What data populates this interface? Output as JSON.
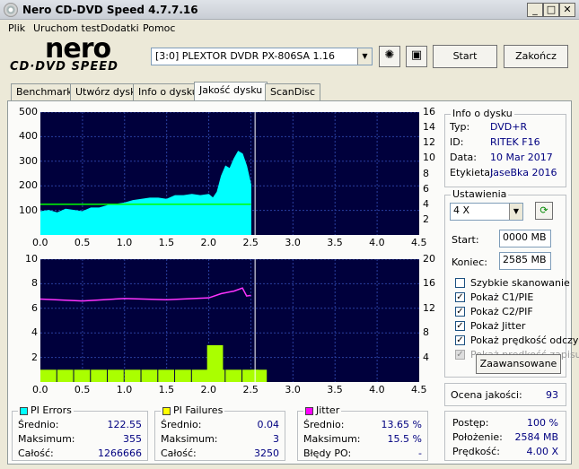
{
  "window": {
    "title": "Nero CD-DVD Speed 4.7.7.16"
  },
  "menu": [
    "Plik",
    "Uruchom test",
    "Dodatki",
    "Pomoc"
  ],
  "logo": {
    "top": "nero",
    "bottom": "CD·DVD SPEED"
  },
  "drive": {
    "selected": "[3:0]  PLEXTOR DVDR   PX-806SA  1.16"
  },
  "buttons": {
    "start": "Start",
    "end": "Zakończ",
    "advanced": "Zaawansowane"
  },
  "tabs": [
    "Benchmark",
    "Utwórz dysk",
    "Info o dysku",
    "Jakość dysku",
    "ScanDisc"
  ],
  "active_tab": 3,
  "disc_info": {
    "title": "Info o dysku",
    "rows": [
      {
        "label": "Typ:",
        "value": "DVD+R"
      },
      {
        "label": "ID:",
        "value": "RITEK F16"
      },
      {
        "label": "Data:",
        "value": "10 Mar 2017"
      },
      {
        "label": "Etykieta:",
        "value": "JaseBka 2016"
      }
    ]
  },
  "settings": {
    "title": "Ustawienia",
    "speed": "4 X",
    "start_label": "Start:",
    "start_value": "0000 MB",
    "end_label": "Koniec:",
    "end_value": "2585 MB",
    "checks": [
      {
        "label": "Szybkie skanowanie",
        "checked": false,
        "disabled": false
      },
      {
        "label": "Pokaż C1/PIE",
        "checked": true,
        "disabled": false
      },
      {
        "label": "Pokaż C2/PIF",
        "checked": true,
        "disabled": false
      },
      {
        "label": "Pokaż Jitter",
        "checked": true,
        "disabled": false
      },
      {
        "label": "Pokaż prędkość odczy",
        "checked": true,
        "disabled": false
      },
      {
        "label": "Pokaż prędkość zapisu",
        "checked": true,
        "disabled": true
      }
    ]
  },
  "quality": {
    "label": "Ocena jakości:",
    "value": "93"
  },
  "progress": {
    "rows": [
      {
        "label": "Postęp:",
        "value": "100 %"
      },
      {
        "label": "Położenie:",
        "value": "2584 MB"
      },
      {
        "label": "Prędkość:",
        "value": "4.00 X"
      }
    ]
  },
  "stats": {
    "pi_errors": {
      "title": "PI Errors",
      "color": "#00ffff",
      "rows": [
        {
          "label": "Średnio:",
          "value": "122.55"
        },
        {
          "label": "Maksimum:",
          "value": "355"
        },
        {
          "label": "Całość:",
          "value": "1266666"
        }
      ]
    },
    "pi_failures": {
      "title": "PI Failures",
      "color": "#ffff00",
      "rows": [
        {
          "label": "Średnio:",
          "value": "0.04"
        },
        {
          "label": "Maksimum:",
          "value": "3"
        },
        {
          "label": "Całość:",
          "value": "3250"
        }
      ]
    },
    "jitter": {
      "title": "Jitter",
      "color": "#ff00ff",
      "rows": [
        {
          "label": "Średnio:",
          "value": "13.65 %"
        },
        {
          "label": "Maksimum:",
          "value": "15.5 %"
        },
        {
          "label": "Błędy PO:",
          "value": "-"
        }
      ]
    }
  },
  "chart_data": [
    {
      "type": "area",
      "x_ticks": [
        "0.0",
        "0.5",
        "1.0",
        "1.5",
        "2.0",
        "2.5",
        "3.0",
        "3.5",
        "4.0",
        "4.5"
      ],
      "xlim": [
        0,
        4.5
      ],
      "y_left_ticks": [
        "500",
        "400",
        "300",
        "200",
        "100"
      ],
      "ylim_left": [
        0,
        500
      ],
      "y_right_ticks": [
        "16",
        "14",
        "12",
        "10",
        "8",
        "6",
        "4",
        "2"
      ],
      "ylim_right": [
        0,
        16
      ],
      "series": [
        {
          "color": "#00ffff",
          "x": [
            0,
            0.1,
            0.2,
            0.3,
            0.4,
            0.5,
            0.6,
            0.7,
            0.8,
            0.9,
            1.0,
            1.1,
            1.2,
            1.3,
            1.4,
            1.5,
            1.6,
            1.7,
            1.8,
            1.9,
            2.0,
            2.05,
            2.1,
            2.15,
            2.2,
            2.25,
            2.3,
            2.35,
            2.4,
            2.45,
            2.5
          ],
          "y": [
            95,
            100,
            90,
            105,
            100,
            95,
            110,
            110,
            120,
            125,
            130,
            140,
            145,
            150,
            150,
            145,
            160,
            160,
            165,
            160,
            165,
            150,
            175,
            240,
            280,
            270,
            310,
            340,
            330,
            280,
            205
          ]
        },
        {
          "color": "#00ff00",
          "axis": "right",
          "x": [
            0,
            2.5
          ],
          "y": [
            4,
            4
          ]
        }
      ],
      "marker_x": 2.55
    },
    {
      "type": "bar",
      "x_ticks": [
        "0.0",
        "0.5",
        "1.0",
        "1.5",
        "2.0",
        "2.5",
        "3.0",
        "3.5",
        "4.0",
        "4.5"
      ],
      "xlim": [
        0,
        4.5
      ],
      "y_left_ticks": [
        "10",
        "8",
        "6",
        "4",
        "2"
      ],
      "ylim_left": [
        0,
        10
      ],
      "y_right_ticks": [
        "20",
        "16",
        "12",
        "8",
        "4"
      ],
      "ylim_right": [
        0,
        20
      ],
      "series": [
        {
          "color": "#aaff00",
          "x": [
            0,
            0.2,
            0.4,
            0.6,
            0.8,
            1.0,
            1.2,
            1.4,
            1.6,
            1.8,
            1.98,
            2.0,
            2.2,
            2.4,
            2.5
          ],
          "y": [
            1,
            1,
            1,
            1,
            1,
            1,
            1,
            1,
            1,
            1,
            3,
            1,
            1,
            1,
            1
          ]
        },
        {
          "color": "#ff33ff",
          "axis": "right",
          "x": [
            0,
            0.5,
            1.0,
            1.5,
            2.0,
            2.15,
            2.3,
            2.4,
            2.45,
            2.5
          ],
          "y": [
            13.5,
            13.2,
            13.6,
            13.4,
            13.7,
            14.4,
            14.8,
            15.3,
            14.0,
            14.1
          ]
        }
      ],
      "marker_x": 2.55
    }
  ]
}
